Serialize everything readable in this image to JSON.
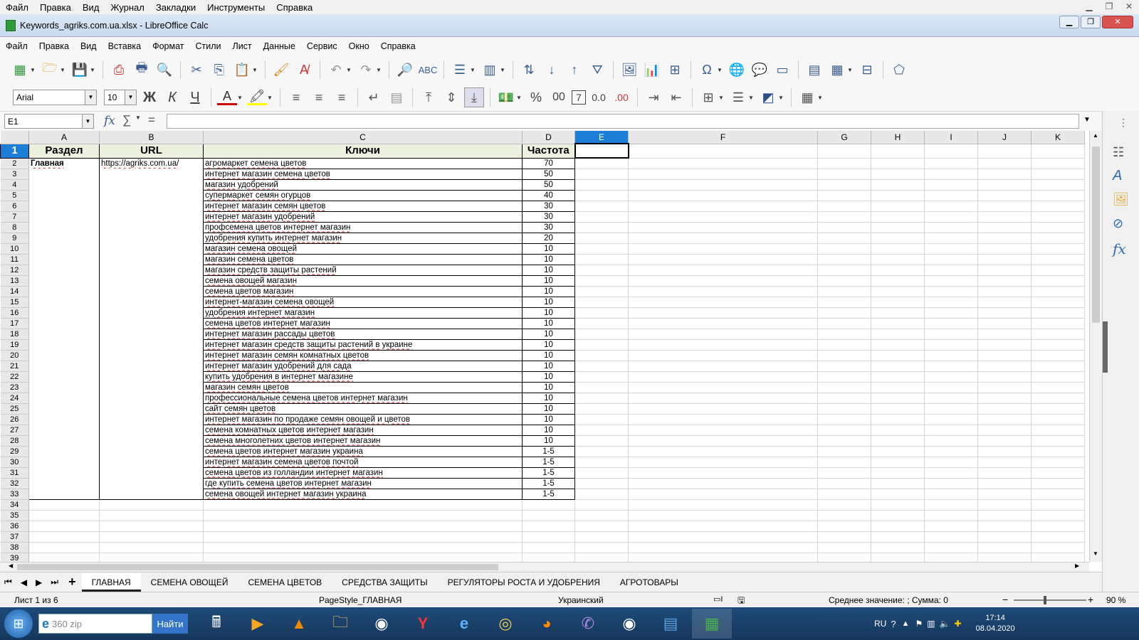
{
  "outer_menu": [
    "Файл",
    "Правка",
    "Вид",
    "Журнал",
    "Закладки",
    "Инструменты",
    "Справка"
  ],
  "window": {
    "title": "Keywords_agriks.com.ua.xlsx - LibreOffice Calc"
  },
  "app_menu": [
    "Файл",
    "Правка",
    "Вид",
    "Вставка",
    "Формат",
    "Стили",
    "Лист",
    "Данные",
    "Сервис",
    "Окно",
    "Справка"
  ],
  "format_bar": {
    "font_name": "Arial",
    "font_size": "10",
    "bold": "Ж",
    "italic": "К",
    "underline": "Ч",
    "percent": "%",
    "number": "00",
    "seven": "7",
    "add_dec": "0.0",
    "del_dec": ".00"
  },
  "formula_bar": {
    "cell_ref": "E1",
    "fx": "fx",
    "sum": "∑",
    "eq": "=",
    "content": ""
  },
  "columns": [
    "A",
    "B",
    "C",
    "D",
    "E",
    "F",
    "G",
    "H",
    "I",
    "J",
    "K"
  ],
  "headers": {
    "a": "Раздел",
    "b": "URL",
    "c": "Ключи",
    "d": "Частота"
  },
  "section": {
    "name": "Главная",
    "url": "https://agriks.com.ua/"
  },
  "rows": [
    {
      "k": "агромаркет семена цветов",
      "f": "70"
    },
    {
      "k": "интернет магазин семена цветов",
      "f": "50"
    },
    {
      "k": "магазин удобрений",
      "f": "50"
    },
    {
      "k": "супермаркет семян огурцов",
      "f": "40"
    },
    {
      "k": "интернет магазин семян цветов",
      "f": "30"
    },
    {
      "k": "интернет магазин удобрений",
      "f": "30"
    },
    {
      "k": "профсемена цветов интернет магазин",
      "f": "30"
    },
    {
      "k": "удобрения купить интернет магазин",
      "f": "20"
    },
    {
      "k": "магазин семена овощей",
      "f": "10"
    },
    {
      "k": "магазин семена цветов",
      "f": "10"
    },
    {
      "k": "магазин средств защиты растений",
      "f": "10"
    },
    {
      "k": "семена овощей магазин",
      "f": "10"
    },
    {
      "k": "семена цветов магазин",
      "f": "10"
    },
    {
      "k": "интернет-магазин семена овощей",
      "f": "10"
    },
    {
      "k": "удобрения интернет магазин",
      "f": "10"
    },
    {
      "k": "семена цветов интернет магазин",
      "f": "10"
    },
    {
      "k": "интернет магазин рассады цветов",
      "f": "10"
    },
    {
      "k": "интернет магазин средств защиты растений в украине",
      "f": "10"
    },
    {
      "k": "интернет магазин семян комнатных цветов",
      "f": "10"
    },
    {
      "k": "интернет магазин удобрений для сада",
      "f": "10"
    },
    {
      "k": "купить удобрения в интернет магазине",
      "f": "10"
    },
    {
      "k": "магазин семян цветов",
      "f": "10"
    },
    {
      "k": "профессиональные семена цветов интернет магазин",
      "f": "10"
    },
    {
      "k": "сайт семян цветов",
      "f": "10"
    },
    {
      "k": "интернет магазин по продаже семян овощей и цветов",
      "f": "10"
    },
    {
      "k": "семена комнатных цветов интернет магазин",
      "f": "10"
    },
    {
      "k": "семена многолетних цветов интернет магазин",
      "f": "10"
    },
    {
      "k": "семена цветов интернет магазин украина",
      "f": "1-5"
    },
    {
      "k": "интернет магазин семена цветов почтой",
      "f": "1-5"
    },
    {
      "k": "семена цветов из голландии интернет магазин",
      "f": "1-5"
    },
    {
      "k": "где купить семена цветов интернет магазин",
      "f": "1-5"
    },
    {
      "k": "семена овощей интернет магазин украина",
      "f": "1-5"
    }
  ],
  "row_numbers": [
    "1",
    "2",
    "3",
    "4",
    "5",
    "6",
    "7",
    "8",
    "9",
    "10",
    "11",
    "12",
    "13",
    "14",
    "15",
    "16",
    "17",
    "18",
    "19",
    "20",
    "21",
    "22",
    "23",
    "24",
    "25",
    "26",
    "27",
    "28",
    "29",
    "30",
    "31",
    "32",
    "33",
    "34",
    "35",
    "36",
    "37",
    "38",
    "39"
  ],
  "sheet_tabs": [
    "ГЛАВНАЯ",
    "СЕМЕНА ОВОЩЕЙ",
    "СЕМЕНА ЦВЕТОВ",
    "СРЕДСТВА ЗАЩИТЫ",
    "РЕГУЛЯТОРЫ РОСТА И УДОБРЕНИЯ",
    "АГРОТОВАРЫ"
  ],
  "status": {
    "sheet": "Лист 1 из 6",
    "page_style": "PageStyle_ГЛАВНАЯ",
    "language": "Украинский",
    "summary": "Среднее значение: ; Сумма: 0",
    "zoom": "90 %"
  },
  "taskbar": {
    "search_placeholder": "360 zip",
    "search_button": "Найти",
    "lang": "RU",
    "time": "17:14",
    "date": "08.04.2020"
  }
}
